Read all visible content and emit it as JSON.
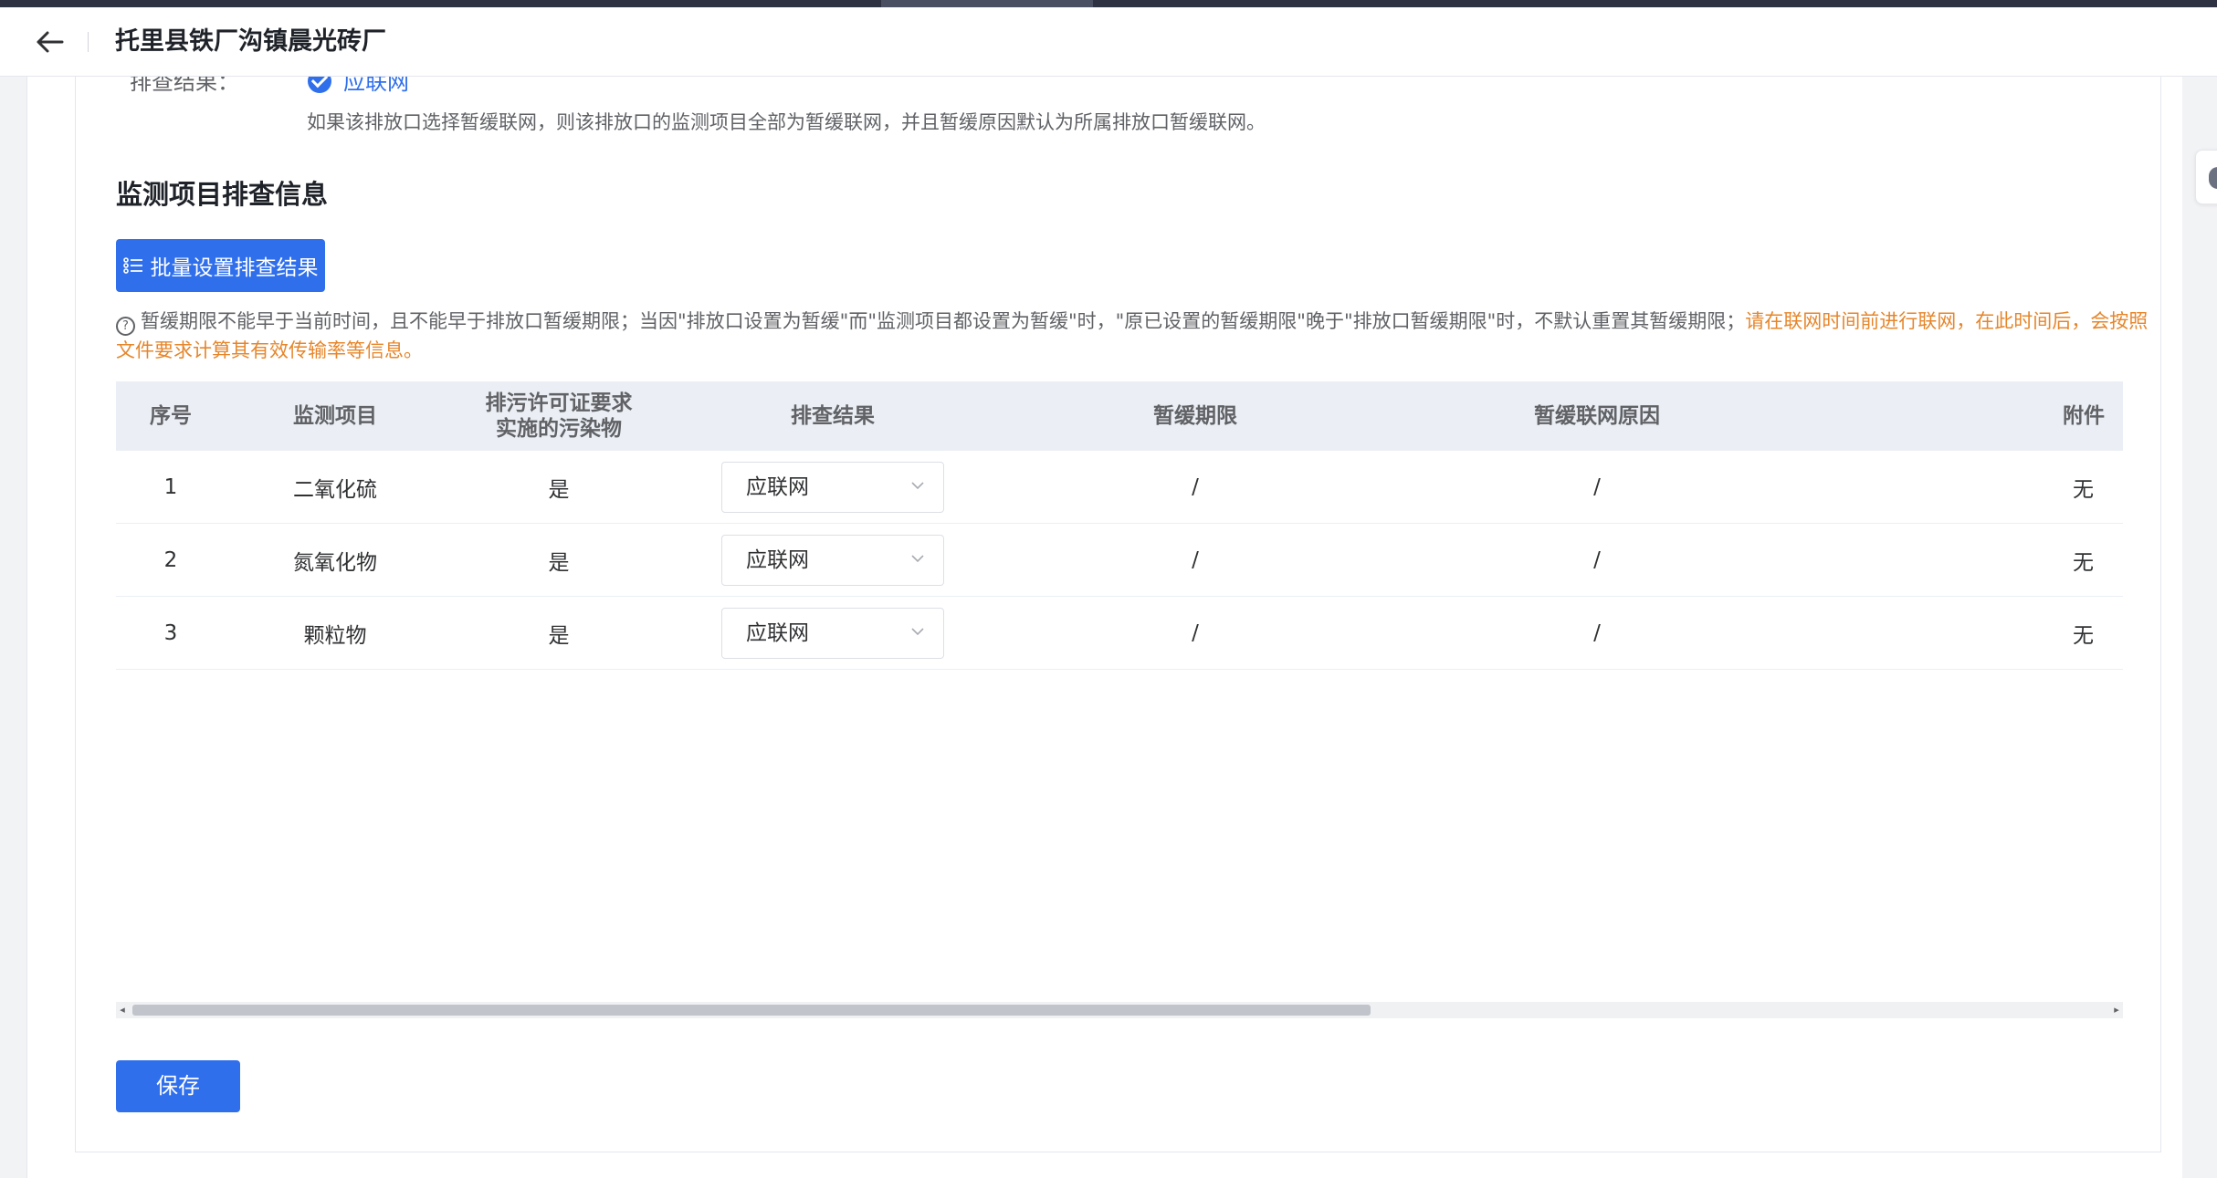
{
  "header": {
    "title": "托里县铁厂沟镇晨光砖厂"
  },
  "previous": {
    "label": "排查结果：",
    "value": "应联网",
    "hint": "如果该排放口选择暂缓联网，则该排放口的监测项目全部为暂缓联网，并且暂缓原因默认为所属排放口暂缓联网。"
  },
  "section": {
    "title": "监测项目排查信息",
    "batch_button": "批量设置排查结果",
    "notice": "暂缓期限不能早于当前时间，且不能早于排放口暂缓期限；当因\"排放口设置为暂缓\"而\"监测项目都设置为暂缓\"时，\"原已设置的暂缓期限\"晚于\"排放口暂缓期限\"时，不默认重置其暂缓期限；",
    "notice_warning": "请在联网时间前进行联网，在此时间后，会按照文件要求计算其有效传输率等信息。"
  },
  "table": {
    "columns": [
      "序号",
      "监测项目",
      "排污许可证要求实施的污染物",
      "排查结果",
      "暂缓期限",
      "暂缓联网原因",
      "附件"
    ],
    "rows": [
      {
        "index": "1",
        "item": "二氧化硫",
        "required": "是",
        "result": "应联网",
        "deadline": "/",
        "reason": "/",
        "attachment": "无"
      },
      {
        "index": "2",
        "item": "氮氧化物",
        "required": "是",
        "result": "应联网",
        "deadline": "/",
        "reason": "/",
        "attachment": "无"
      },
      {
        "index": "3",
        "item": "颗粒物",
        "required": "是",
        "result": "应联网",
        "deadline": "/",
        "reason": "/",
        "attachment": "无"
      }
    ]
  },
  "footer": {
    "save_button": "保存"
  },
  "colors": {
    "primary": "#2f6fec",
    "warning": "#e6862b",
    "header_bg": "#ebeef4"
  },
  "icons": [
    "back-arrow-icon",
    "check-circle-icon",
    "list-icon",
    "help-circle-icon",
    "chevron-down-icon"
  ]
}
